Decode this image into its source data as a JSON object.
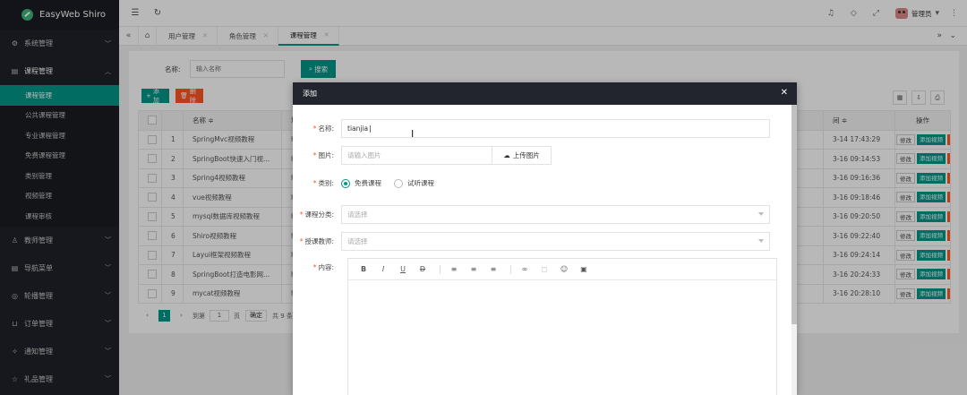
{
  "app": {
    "title": "EasyWeb Shiro"
  },
  "sidebar": {
    "groups": [
      {
        "label": "系统管理",
        "icon": "gear-icon"
      },
      {
        "label": "课程管理",
        "icon": "course-icon"
      },
      {
        "label": "教师管理",
        "icon": "user-icon"
      },
      {
        "label": "导航菜单",
        "icon": "nav-icon"
      },
      {
        "label": "轮播管理",
        "icon": "carousel-icon"
      },
      {
        "label": "订单管理",
        "icon": "cart-icon"
      },
      {
        "label": "通知管理",
        "icon": "bell-icon"
      },
      {
        "label": "礼品管理",
        "icon": "gift-icon"
      }
    ],
    "course_sub": [
      "课程管理",
      "公共课程管理",
      "专业课程管理",
      "免费课程管理",
      "类别管理",
      "视频管理",
      "课程审核"
    ]
  },
  "header": {
    "user": "管理员"
  },
  "tabs": [
    {
      "label": "用户管理"
    },
    {
      "label": "角色管理"
    },
    {
      "label": "课程管理"
    }
  ],
  "search": {
    "label": "名称:",
    "placeholder": "输入名称",
    "button": "搜索"
  },
  "toolbar": {
    "add": "添加",
    "delete": "删除"
  },
  "table": {
    "headers": {
      "name": "名称 ≑",
      "addr": "地",
      "time": "间 ≑",
      "ops": "操作"
    },
    "ops": {
      "edit": "修改",
      "add_video": "添加视频",
      "delete": "删除"
    },
    "rows": [
      {
        "no": "1",
        "name": "SpringMvc视频教程",
        "addr": "ht",
        "time": "3-14 17:43:29"
      },
      {
        "no": "2",
        "name": "SpringBoot快速入门视...",
        "addr": "ht",
        "time": "3-16 09:14:53"
      },
      {
        "no": "3",
        "name": "Spring4视频教程",
        "addr": "ht",
        "time": "3-16 09:16:36"
      },
      {
        "no": "4",
        "name": "vue视频教程",
        "addr": "ht",
        "time": "3-16 09:18:46"
      },
      {
        "no": "5",
        "name": "mysql数据库视频教程",
        "addr": "ht",
        "time": "3-16 09:20:50"
      },
      {
        "no": "6",
        "name": "Shiro视频教程",
        "addr": "ht",
        "time": "3-16 09:22:40"
      },
      {
        "no": "7",
        "name": "Layui框架视频教程",
        "addr": "ht",
        "time": "3-16 09:24:14"
      },
      {
        "no": "8",
        "name": "SpringBoot打造电影网...",
        "addr": "ht",
        "time": "3-16 20:24:33"
      },
      {
        "no": "9",
        "name": "mycat视频教程",
        "addr": "ht",
        "time": "3-16 20:28:10"
      }
    ]
  },
  "pager": {
    "current": "1",
    "goto_label": "到第",
    "page_input": "1",
    "page_unit": "页",
    "confirm": "确定",
    "total": "共 9 条"
  },
  "modal": {
    "title": "添加",
    "name_label": "名称:",
    "name_value": "tianjia",
    "image_label": "图片:",
    "image_placeholder": "请输入图片",
    "upload_button": "上传图片",
    "category_label": "类别:",
    "category_options": [
      "免费课程",
      "试听课程"
    ],
    "category_selected": "免费课程",
    "course_class_label": "课程分类:",
    "course_class_placeholder": "请选择",
    "teacher_label": "授课教师:",
    "teacher_placeholder": "请选择",
    "content_label": "内容:"
  }
}
